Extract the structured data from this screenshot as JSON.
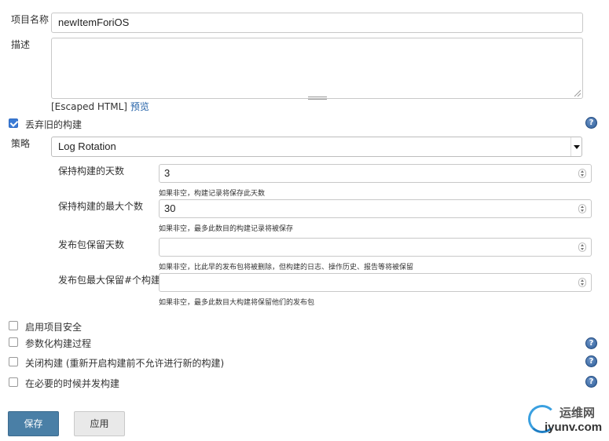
{
  "project_name": {
    "label": "项目名称",
    "value": "newItemForiOS"
  },
  "description": {
    "label": "描述",
    "escaped_html": "[Escaped HTML]",
    "preview": "预览"
  },
  "discard_old": {
    "label": "丢弃旧的构建",
    "checked": true
  },
  "strategy": {
    "label": "策略",
    "selected": "Log Rotation"
  },
  "fields": [
    {
      "label": "保持构建的天数",
      "value": "3",
      "hint": "如果非空，构建记录将保存此天数"
    },
    {
      "label": "保持构建的最大个数",
      "value": "30",
      "hint": "如果非空，最多此数目的构建记录将被保存"
    },
    {
      "label": "发布包保留天数",
      "value": "",
      "hint": "如果非空，比此早的发布包将被删除，但构建的日志、操作历史、报告等将被保留"
    },
    {
      "label": "发布包最大保留#个构建",
      "value": "",
      "hint": "如果非空，最多此数目大构建将保留他们的发布包"
    }
  ],
  "options": [
    {
      "label": "启用项目安全",
      "checked": false
    },
    {
      "label": "参数化构建过程",
      "checked": false
    },
    {
      "label": "关闭构建 (重新开启构建前不允许进行新的构建)",
      "checked": false
    },
    {
      "label": "在必要的时候并发构建",
      "checked": false
    }
  ],
  "buttons": {
    "save": "保存",
    "apply": "应用"
  },
  "help_glyph": "?",
  "watermark": {
    "cn": "运维网",
    "en": "iyunv.com"
  },
  "colors": {
    "primary": "#4a7fa6",
    "link": "#2462a8",
    "checkbox": "#3a7bd5",
    "help": "#2e5d98"
  }
}
